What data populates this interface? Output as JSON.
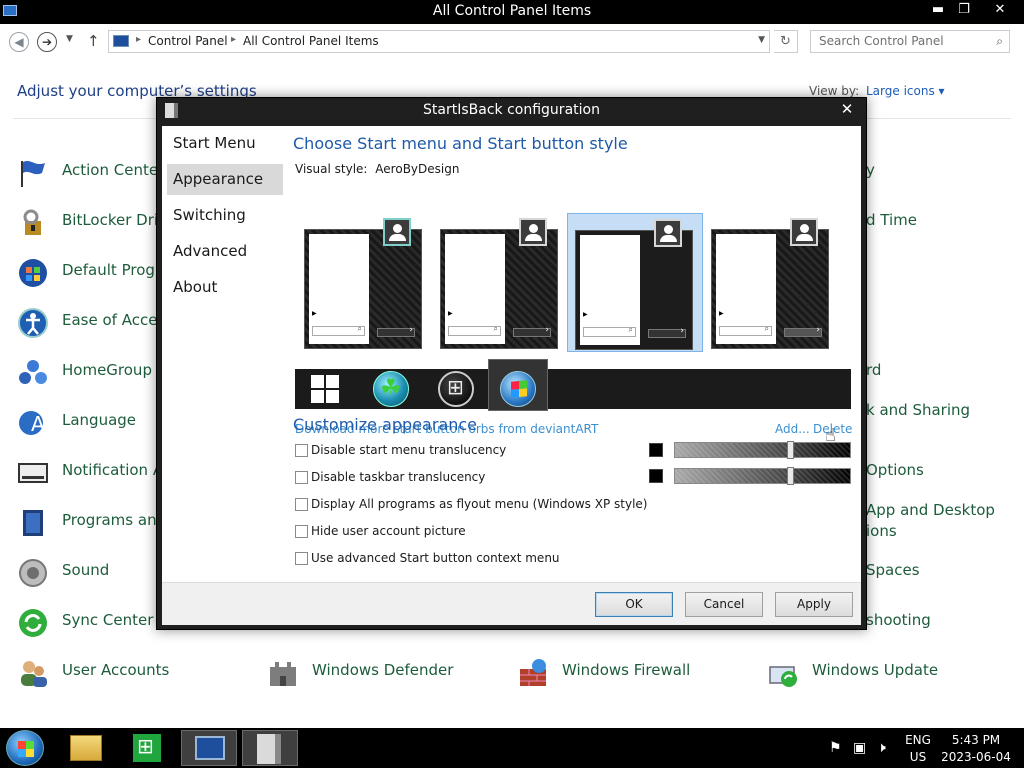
{
  "window": {
    "title": "All Control Panel Items",
    "min_label": "▬",
    "max_label": "❐",
    "close_label": "✕"
  },
  "nav": {
    "back_icon": "◀",
    "forward_icon": "➔",
    "up_icon": "↑",
    "breadcrumb": [
      "Control Panel",
      "All Control Panel Items"
    ],
    "search_placeholder": "Search Control Panel"
  },
  "panel": {
    "heading": "Adjust your computer’s settings",
    "view_by_label": "View by:",
    "view_by_value": "Large icons ▾"
  },
  "items_left": [
    "Action Center",
    "BitLocker Drive",
    "Default Progr",
    "Ease of Access",
    "HomeGroup",
    "Language",
    "Notification A",
    "Programs and",
    "Sound",
    "Sync Center",
    "User Accounts"
  ],
  "items_bottom": [
    "Windows Defender",
    "Windows Firewall",
    "Windows Update"
  ],
  "items_right_fragments": [
    "y",
    "d Time",
    "rd",
    "k and Sharing",
    "Options",
    "App and Desktop",
    "ions",
    "Spaces",
    "shooting"
  ],
  "dialog": {
    "title": "StartIsBack configuration",
    "close_label": "✕",
    "nav": [
      "Start Menu",
      "Appearance",
      "Switching",
      "Advanced",
      "About"
    ],
    "active_nav": "Appearance",
    "style_heading": "Choose Start menu and Start button style",
    "visual_style_label": "Visual style:",
    "visual_style_value": "AeroByDesign",
    "selected_style_index": 2,
    "download_link": "Download more start button orbs from deviantART",
    "add_link": "Add...",
    "delete_link": "Delete",
    "customize_heading": "Customize appearance",
    "checkboxes": [
      {
        "label": "Disable start menu translucency",
        "checked": false
      },
      {
        "label": "Disable taskbar translucency",
        "checked": false
      },
      {
        "label": "Display All programs as flyout menu (Windows XP style)",
        "checked": false
      },
      {
        "label": "Hide user account picture",
        "checked": false
      },
      {
        "label": "Use advanced Start button context menu",
        "checked": false
      }
    ],
    "start_menu_color": "#000000",
    "taskbar_color": "#000000",
    "buttons": {
      "ok": "OK",
      "cancel": "Cancel",
      "apply": "Apply"
    }
  },
  "taskbar": {
    "language": "ENG",
    "region": "US",
    "time": "5:43 PM",
    "date": "2023-06-04"
  }
}
